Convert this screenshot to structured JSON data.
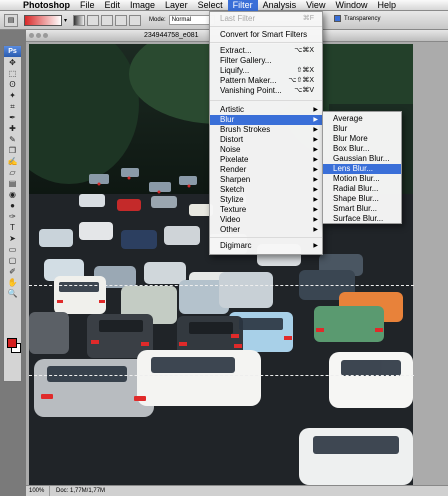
{
  "menubar": {
    "apple": "",
    "items": [
      "Photoshop",
      "File",
      "Edit",
      "Image",
      "Layer",
      "Select",
      "Filter",
      "Analysis",
      "View",
      "Window",
      "Help"
    ],
    "active": "Filter"
  },
  "options_bar": {
    "mode_label": "Mode:",
    "mode_value": "Normal",
    "transparency_label": "Transparency"
  },
  "tools": {
    "ps_label": "Ps",
    "icons": [
      "move-icon",
      "marquee-icon",
      "lasso-icon",
      "quick-select-icon",
      "crop-icon",
      "eyedropper-icon",
      "healing-icon",
      "brush-icon",
      "clone-stamp-icon",
      "history-brush-icon",
      "eraser-icon",
      "gradient-icon",
      "blur-tool-icon",
      "dodge-icon",
      "pen-icon",
      "type-icon",
      "path-select-icon",
      "shape-icon",
      "notes-icon",
      "eyedropper2-icon",
      "hand-icon",
      "zoom-icon"
    ],
    "glyphs": [
      "✥",
      "⬚",
      "ʘ",
      "✦",
      "⌗",
      "✒",
      "✚",
      "✎",
      "❒",
      "✍",
      "▱",
      "▤",
      "◉",
      "●",
      "✑",
      "T",
      "➤",
      "▭",
      "▢",
      "✐",
      "✋",
      "🔍"
    ],
    "foreground_color": "#d42020",
    "background_color": "#ffffff"
  },
  "document": {
    "title": "234944758_e081",
    "zoom": "100%",
    "status": "Doc: 1,77M/1,77M"
  },
  "filter_menu": {
    "last_filter": {
      "label": "Last Filter",
      "shortcut": "⌘F"
    },
    "convert": "Convert for Smart Filters",
    "group_a": [
      {
        "label": "Extract...",
        "shortcut": "⌥⌘X"
      },
      {
        "label": "Filter Gallery...",
        "shortcut": ""
      },
      {
        "label": "Liquify...",
        "shortcut": "⇧⌘X"
      },
      {
        "label": "Pattern Maker...",
        "shortcut": "⌥⇧⌘X"
      },
      {
        "label": "Vanishing Point...",
        "shortcut": "⌥⌘V"
      }
    ],
    "group_b": [
      "Artistic",
      "Blur",
      "Brush Strokes",
      "Distort",
      "Noise",
      "Pixelate",
      "Render",
      "Sharpen",
      "Sketch",
      "Stylize",
      "Texture",
      "Video",
      "Other"
    ],
    "highlighted": "Blur",
    "digimarc": "Digimarc"
  },
  "blur_submenu": {
    "items": [
      "Average",
      "Blur",
      "Blur More",
      "Box Blur...",
      "Gaussian Blur...",
      "Lens Blur...",
      "Motion Blur...",
      "Radial Blur...",
      "Shape Blur...",
      "Smart Blur...",
      "Surface Blur..."
    ],
    "highlighted": "Lens Blur..."
  },
  "colors": {
    "menu_highlight": "#3a6fd8"
  }
}
